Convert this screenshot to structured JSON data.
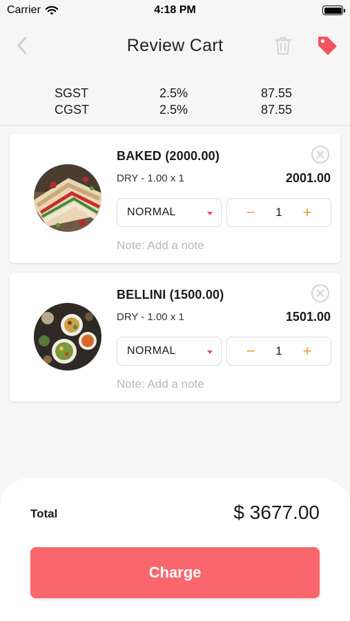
{
  "status_bar": {
    "carrier": "Carrier",
    "time": "4:18 PM"
  },
  "nav": {
    "title": "Review Cart"
  },
  "taxes": [
    {
      "name": "SGST",
      "rate": "2.5%",
      "amount": "87.55"
    },
    {
      "name": "CGST",
      "rate": "2.5%",
      "amount": "87.55"
    }
  ],
  "items": [
    {
      "name": "BAKED (2000.00)",
      "meta": "DRY  - 1.00 x 1",
      "price": "2001.00",
      "variant": "NORMAL",
      "quantity": "1",
      "note_placeholder": "Note: Add a note",
      "image": "sandwich-photo"
    },
    {
      "name": "BELLINI (1500.00)",
      "meta": "DRY  - 1.00 x 1",
      "price": "1501.00",
      "variant": "NORMAL",
      "quantity": "1",
      "note_placeholder": "Note: Add a note",
      "image": "food-platter-photo"
    }
  ],
  "stepper": {
    "minus": "−",
    "plus": "+"
  },
  "summary": {
    "total_label": "Total",
    "total_value": "$ 3677.00"
  },
  "actions": {
    "charge_label": "Charge"
  },
  "colors": {
    "accent": "#f9676c",
    "stepper": "#f0962f",
    "caret": "#e0535b",
    "placeholder": "#b8b8b8",
    "background": "#f6f6f6"
  },
  "icons": {
    "back": "chevron-left-icon",
    "trash": "trash-icon",
    "tag": "tag-icon",
    "remove": "close-circle-icon",
    "wifi": "wifi-icon",
    "battery": "battery-icon"
  }
}
